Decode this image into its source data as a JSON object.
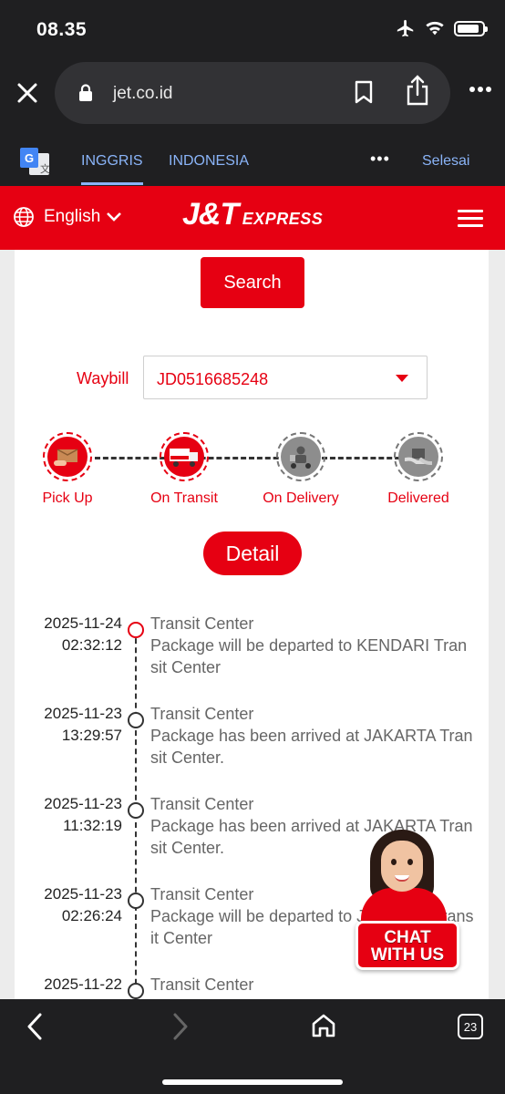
{
  "status_bar": {
    "time": "08.35",
    "battery_level": 0.9
  },
  "browser": {
    "url": "jet.co.id",
    "tab_count": "23"
  },
  "translate": {
    "tab_english": "INGGRIS",
    "tab_indonesian": "INDONESIA",
    "more": "•••",
    "done": "Selesai"
  },
  "header": {
    "language": "English",
    "logo_main": "J&T",
    "logo_sub": "EXPRESS"
  },
  "search": {
    "button_label": "Search"
  },
  "waybill": {
    "label": "Waybill",
    "value": "JD0516685248"
  },
  "steps": [
    {
      "label": "Pick Up",
      "state": "done",
      "icon": "pickup-icon"
    },
    {
      "label": "On Transit",
      "state": "done",
      "icon": "truck-icon"
    },
    {
      "label": "On Delivery",
      "state": "pending",
      "icon": "courier-icon"
    },
    {
      "label": "Delivered",
      "state": "pending",
      "icon": "handover-icon"
    }
  ],
  "detail": {
    "button_label": "Detail"
  },
  "timeline": [
    {
      "date": "2025-11-24",
      "time": "02:32:12",
      "title": "Transit Center",
      "desc": "Package will be departed to KENDARI Transit Center"
    },
    {
      "date": "2025-11-23",
      "time": "13:29:57",
      "title": "Transit Center",
      "desc": "Package has been arrived at JAKARTA Transit Center."
    },
    {
      "date": "2025-11-23",
      "time": "11:32:19",
      "title": "Transit Center",
      "desc": "Package has been arrived at JAKARTA Transit Center."
    },
    {
      "date": "2025-11-23",
      "time": "02:26:24",
      "title": "Transit Center",
      "desc": "Package will be departed to JAKARTA Transit Center"
    },
    {
      "date": "2025-11-22",
      "time": "",
      "title": "Transit Center",
      "desc": ""
    }
  ],
  "chat": {
    "line1": "CHAT",
    "line2": "WITH US"
  },
  "colors": {
    "brand_red": "#e60012",
    "browser_dark": "#1f1f21",
    "link_blue": "#8ab4f8"
  }
}
